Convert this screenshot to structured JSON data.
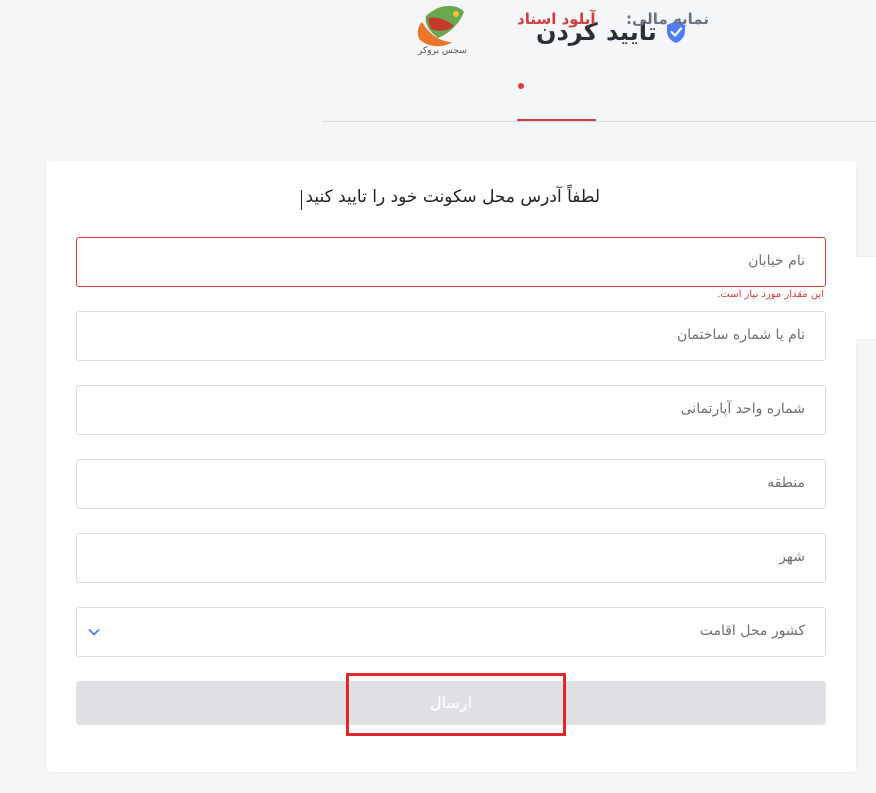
{
  "header": {
    "title": "تایید کردن",
    "logo_text": "سجس بروکر"
  },
  "tabs": [
    {
      "label": "نمایه مالی:"
    },
    {
      "label": "آپلود اسناد"
    }
  ],
  "form": {
    "title": "لطفاً آدرس محل سکونت خود را تایید کنید",
    "fields": [
      {
        "placeholder": "نام خیابان",
        "error": "این مقدار مورد نیاز است."
      },
      {
        "placeholder": "نام یا شماره ساختمان"
      },
      {
        "placeholder": "شماره واحد آپارتمانی"
      },
      {
        "placeholder": "منطقه"
      },
      {
        "placeholder": "شهر"
      },
      {
        "placeholder": "کشور محل اقامت"
      }
    ],
    "submit_label": "ارسال"
  },
  "colors": {
    "accent_red": "#d13c3c",
    "shield_blue": "#4f7cf7",
    "highlight": "#e0262d"
  }
}
